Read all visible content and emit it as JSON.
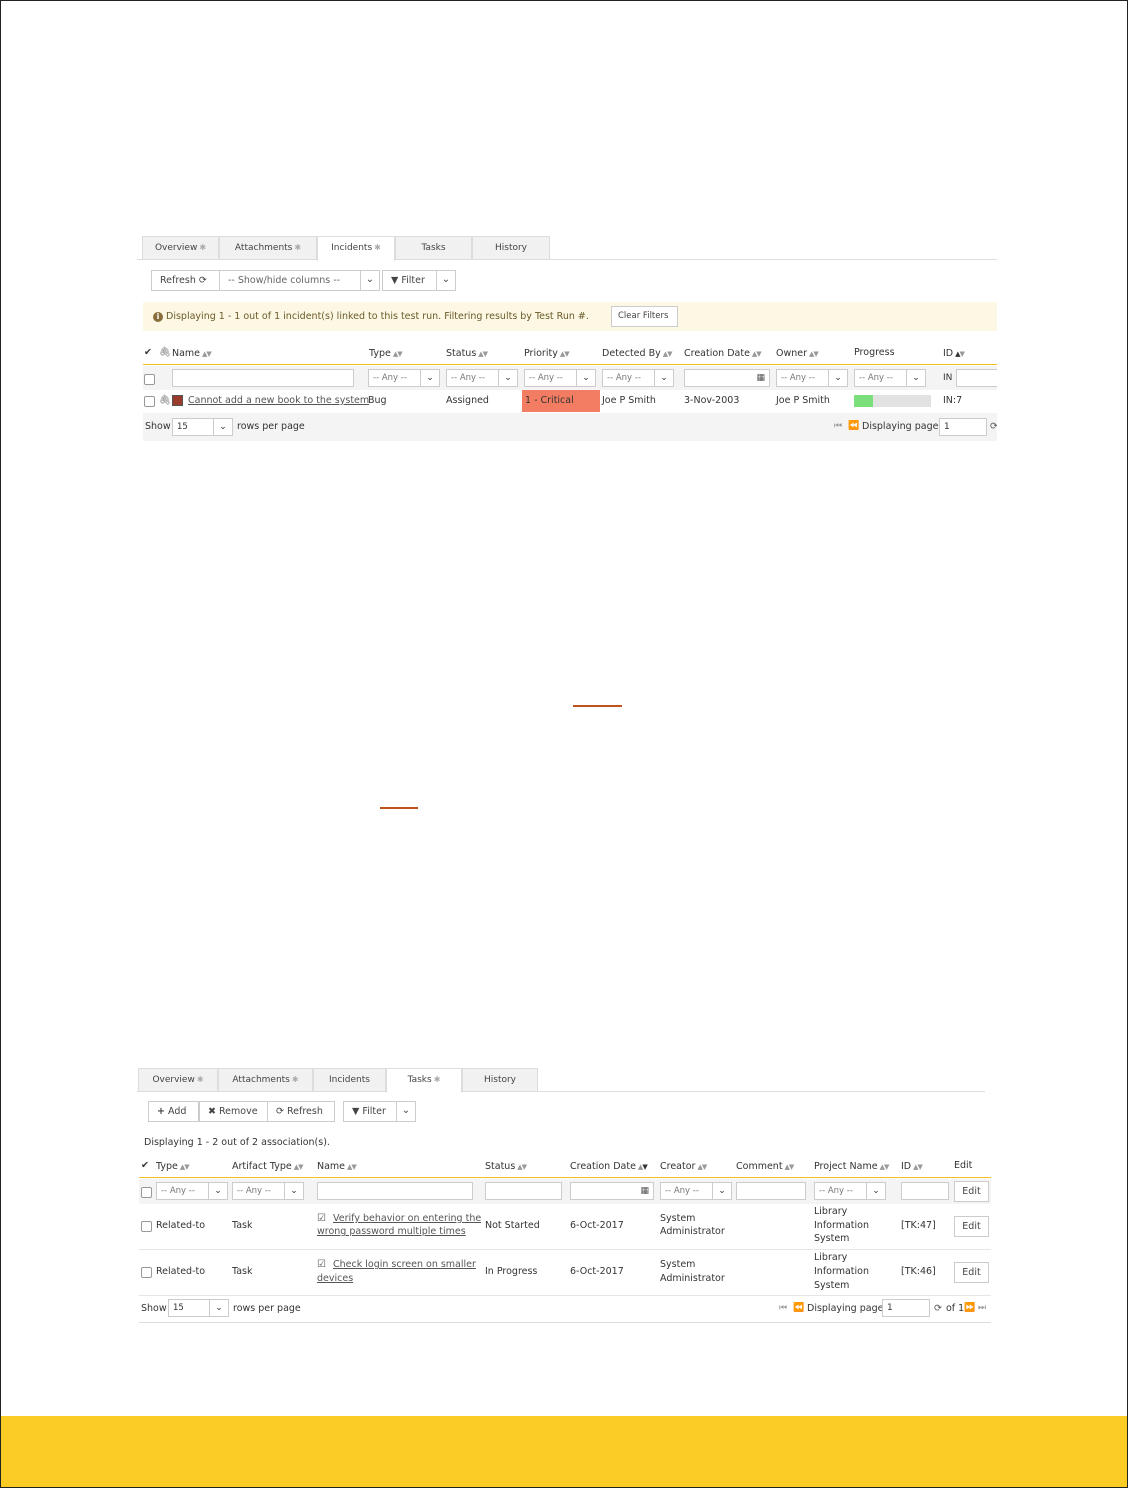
{
  "incidents_panel": {
    "tabs": [
      {
        "label": "Overview",
        "star": "✱"
      },
      {
        "label": "Attachments",
        "star": "✱"
      },
      {
        "label": "Incidents",
        "star": "✱"
      },
      {
        "label": "Tasks",
        "star": ""
      },
      {
        "label": "History",
        "star": ""
      }
    ],
    "active_tab": "Incidents",
    "toolbar": {
      "refresh": "Refresh",
      "show_hide": "-- Show/hide columns --",
      "filter": "Filter"
    },
    "notice": "Displaying 1 - 1 out of 1 incident(s) linked to this test run. Filtering results by Test Run #.",
    "clear_filters": "Clear Filters",
    "columns": [
      "Name",
      "Type",
      "Status",
      "Priority",
      "Detected By",
      "Creation Date",
      "Owner",
      "Progress",
      "ID"
    ],
    "filter_any": "-- Any --",
    "id_filter": "IN",
    "rows": [
      {
        "name": "Cannot add a new book to the system",
        "type": "Bug",
        "status": "Assigned",
        "priority": "1 - Critical",
        "detected_by": "Joe P Smith",
        "creation_date": "3-Nov-2003",
        "owner": "Joe P Smith",
        "progress": 0.25,
        "id": "IN:7"
      }
    ],
    "pager": {
      "show": "Show",
      "rows_value": "15",
      "rows_per_page": "rows per page",
      "displaying_page": "Displaying page",
      "page": "1"
    }
  },
  "tasks_panel": {
    "tabs": [
      {
        "label": "Overview",
        "star": "✱"
      },
      {
        "label": "Attachments",
        "star": "✱"
      },
      {
        "label": "Incidents",
        "star": ""
      },
      {
        "label": "Tasks",
        "star": "✱"
      },
      {
        "label": "History",
        "star": ""
      }
    ],
    "active_tab": "Tasks",
    "toolbar": {
      "add": "Add",
      "remove": "Remove",
      "refresh": "Refresh",
      "filter": "Filter"
    },
    "summary": "Displaying 1 - 2 out of 2 association(s).",
    "columns": [
      "Type",
      "Artifact Type",
      "Name",
      "Status",
      "Creation Date",
      "Creator",
      "Comment",
      "Project Name",
      "ID",
      "Edit"
    ],
    "filter_any": "-- Any --",
    "edit_label": "Edit",
    "rows": [
      {
        "type": "Related-to",
        "artifact_type": "Task",
        "name_line1": "Verify behavior on entering the",
        "name_line2": "wrong password multiple times",
        "status": "Not Started",
        "creation_date": "6-Oct-2017",
        "creator_line1": "System",
        "creator_line2": "Administrator",
        "project_line1": "Library",
        "project_line2": "Information",
        "project_line3": "System",
        "id": "[TK:47]"
      },
      {
        "type": "Related-to",
        "artifact_type": "Task",
        "name_line1": "Check login screen on smaller",
        "name_line2": "devices",
        "status": "In Progress",
        "creation_date": "6-Oct-2017",
        "creator_line1": "System",
        "creator_line2": "Administrator",
        "project_line1": "Library",
        "project_line2": "Information",
        "project_line3": "System",
        "id": "[TK:46]"
      }
    ],
    "pager": {
      "show": "Show",
      "rows_value": "15",
      "rows_per_page": "rows per page",
      "displaying_page": "Displaying page",
      "page": "1",
      "of": "of 1"
    }
  },
  "colors": {
    "priority_critical": "#f27d62",
    "notice_bg": "#fcf8e3",
    "progress_fill": "#7be07b",
    "footer_band": "#fbcb26",
    "accent_line": "#c0531b"
  }
}
